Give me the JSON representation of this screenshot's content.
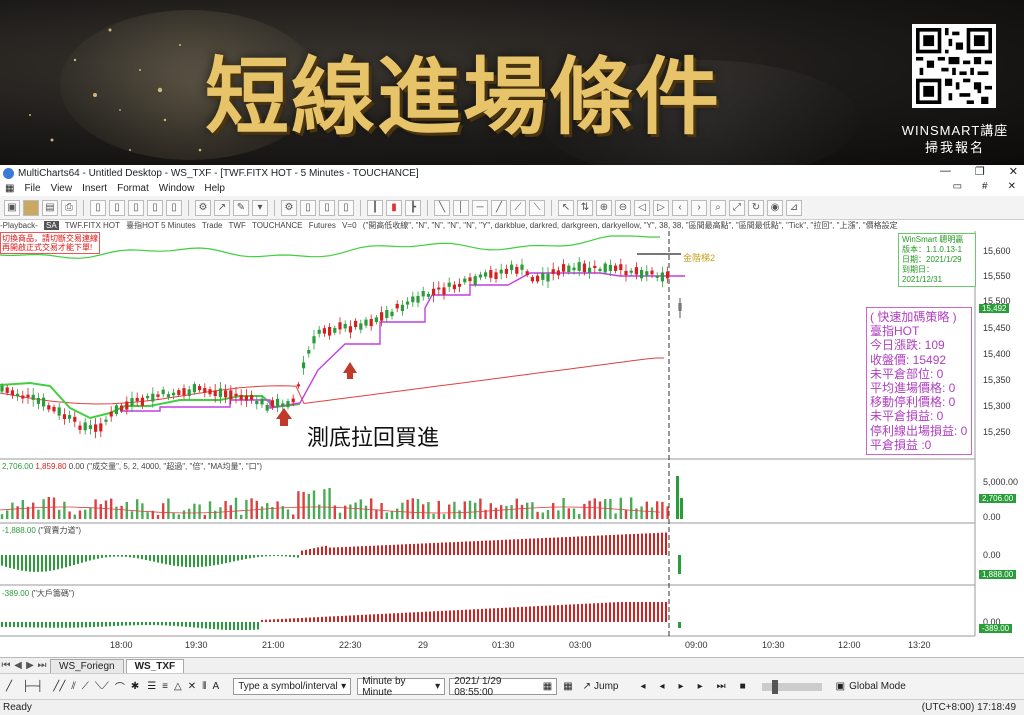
{
  "banner": {
    "title": "短線進場條件",
    "qr_caption_1": "WINSMART講座",
    "qr_caption_2": "掃我報名"
  },
  "window": {
    "title": "MultiCharts64 - Untitled Desktop - WS_TXF - [TWF.FITX HOT - 5 Minutes - TOUCHANCE]",
    "minimize_glyph": "—",
    "maximize_glyph": "❐",
    "close_glyph": "✕"
  },
  "menu": [
    "File",
    "View",
    "Insert",
    "Format",
    "Window",
    "Help"
  ],
  "info_row": {
    "playback": "-Playback-",
    "sa": "SA",
    "symbol": "TWF.FITX HOT",
    "interval": "臺指HOT 5 Minutes",
    "trade": "Trade",
    "exchange": "TWF",
    "source": "TOUCHANCE",
    "futures": "Futures",
    "v": "V=0",
    "params": "(\"開高低收線\", \"N\", \"N\", \"N\", \"N\", \"Y\", darkblue, darkred, darkgreen, darkyellow, \"Y\", 38, 38, \"區間最高點\", \"區間最低點\", \"Tick\", \"拉回\", \"上漲\", \"價格設定"
  },
  "warning": [
    "切換商品，請切斷交易連線",
    "再開啟正式交易才能下單!"
  ],
  "winsmart_box": [
    "WinSmart 聰明贏",
    "版本：1.1.0.13-1",
    "日期：2021/1/29",
    "到期日：2021/12/31"
  ],
  "gold_label": "金階梯2",
  "strategy": {
    "title": "( 快速加碼策略 )",
    "symbol": "臺指HOT",
    "today_change": "今日漲跌: 109",
    "close": "收盤價: 15492",
    "open_pos": "未平倉部位: 0",
    "avg_entry": "平均進場價格: 0",
    "trail_stop": "移動停利價格: 0",
    "open_pnl": "未平倉損益: 0",
    "exit_pnl": "停利線出場損益: 0",
    "closed_pnl": "平倉損益 :0"
  },
  "caption": "測底拉回買進",
  "price_axis": [
    "15,600",
    "15,550",
    "15,500",
    "15,450",
    "15,400",
    "15,350",
    "15,300",
    "15,250"
  ],
  "price_tag": "15,492",
  "volume_panel": {
    "label_vals": [
      "2,706.00",
      "1,859.80",
      "0.00"
    ],
    "params": "(\"成交量\", 5, 2, 4000, \"超過\", \"倍\", \"MA均量\", \"口\")",
    "axis": [
      "5,000.00",
      "2,706.00",
      "0.00"
    ]
  },
  "power_panel": {
    "label_val": "-1,888.00",
    "params": "(\"買賣力道\")",
    "axis": [
      "0.00",
      "1,888.00"
    ]
  },
  "big_panel": {
    "label_val": "-389.00",
    "params": "(\"大戶籌碼\")",
    "axis": [
      "0.00",
      "-389.00"
    ]
  },
  "time_axis": [
    "18:00",
    "19:30",
    "21:00",
    "22:30",
    "29",
    "01:30",
    "03:00",
    "09:00",
    "10:30",
    "12:00",
    "13:20"
  ],
  "sheets": [
    "WS_Foriegn",
    "WS_TXF"
  ],
  "bottom": {
    "symbol_placeholder": "Type a symbol/interval",
    "mode": "Minute by Minute",
    "datetime": "2021/  1/29 08:55:00",
    "jump": "Jump",
    "global": "Global Mode"
  },
  "status": {
    "ready": "Ready",
    "clock": "(UTC+8:00) 17:18:49"
  },
  "colors": {
    "up": "#d62020",
    "down": "#2a9d3a",
    "ma_red": "#e04040",
    "ma_green": "#3fcf3f",
    "step_magenta": "#c040e0",
    "gold": "#e7c46a"
  }
}
